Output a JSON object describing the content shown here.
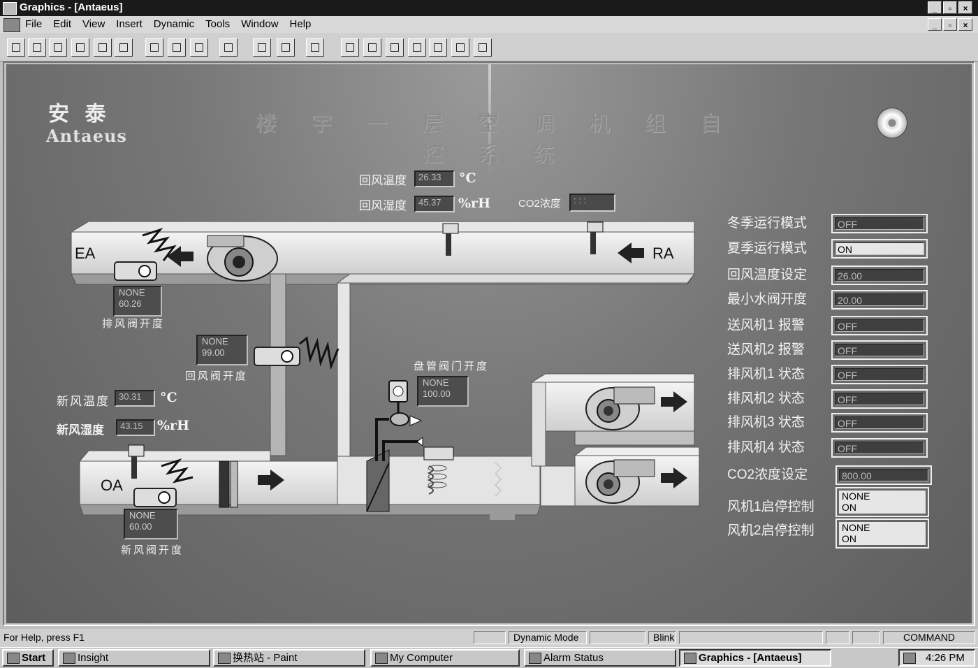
{
  "window": {
    "title": "Graphics - [Antaeus]",
    "doc_controls": [
      "_",
      "▫",
      "×"
    ]
  },
  "menu": [
    "File",
    "Edit",
    "View",
    "Insert",
    "Dynamic",
    "Tools",
    "Window",
    "Help"
  ],
  "logo": {
    "cn": "安 泰",
    "en": "Antaeus"
  },
  "page_title": "楼 宇 一 层 空 调 机 组 自 控 系 统",
  "duct_labels": {
    "ea": "EA",
    "ra": "RA",
    "oa": "OA"
  },
  "return_air": {
    "temp_label": "回风温度",
    "temp_value": "26.33",
    "temp_unit": "°C",
    "hum_label": "回风湿度",
    "hum_value": "45.37",
    "hum_unit": "%rH",
    "co2_label": "CO2浓度",
    "co2_value": ":  :  :"
  },
  "exhaust_damper": {
    "status": "NONE",
    "value": "60.26",
    "label": "排风阀开度"
  },
  "return_damper": {
    "status": "NONE",
    "value": "99.00",
    "label": "回风阀开度"
  },
  "fresh_damper": {
    "status": "NONE",
    "value": "60.00",
    "label": "新风阀开度"
  },
  "coil_valve": {
    "status": "NONE",
    "value": "100.00",
    "label": "盘管阀门开度"
  },
  "fresh_air": {
    "temp_label": "新风温度",
    "temp_value": "30.31",
    "temp_unit": "°C",
    "hum_label": "新风湿度",
    "hum_value": "43.15",
    "hum_unit": "%rH"
  },
  "settings": [
    {
      "label": "冬季运行模式",
      "value": "OFF",
      "on": false
    },
    {
      "label": "夏季运行模式",
      "value": "ON",
      "on": true
    },
    {
      "label": "回风温度设定",
      "value": "26.00",
      "on": false
    },
    {
      "label": "最小水阀开度",
      "value": "20.00",
      "on": false
    },
    {
      "label": "送风机1 报警",
      "value": "OFF",
      "on": false
    },
    {
      "label": "送风机2 报警",
      "value": "OFF",
      "on": false
    },
    {
      "label": "排风机1 状态",
      "value": "OFF",
      "on": false
    },
    {
      "label": "排风机2 状态",
      "value": "OFF",
      "on": false
    },
    {
      "label": "排风机3 状态",
      "value": "OFF",
      "on": false
    },
    {
      "label": "排风机4 状态",
      "value": "OFF",
      "on": false
    },
    {
      "label": "CO2浓度设定",
      "value": "800.00",
      "on": false
    }
  ],
  "controls": [
    {
      "label": "风机1启停控制",
      "line1": "NONE",
      "line2": "ON"
    },
    {
      "label": "风机2启停控制",
      "line1": "NONE",
      "line2": "ON"
    }
  ],
  "status": {
    "help": "For Help, press F1",
    "mode": "Dynamic Mode",
    "blink": "Blink",
    "command": "COMMAND"
  },
  "taskbar": [
    "Start",
    "Insight",
    "换热站 - Paint",
    "My Computer",
    "Alarm Status",
    "Graphics - [Antaeus]",
    "4:26 PM"
  ]
}
